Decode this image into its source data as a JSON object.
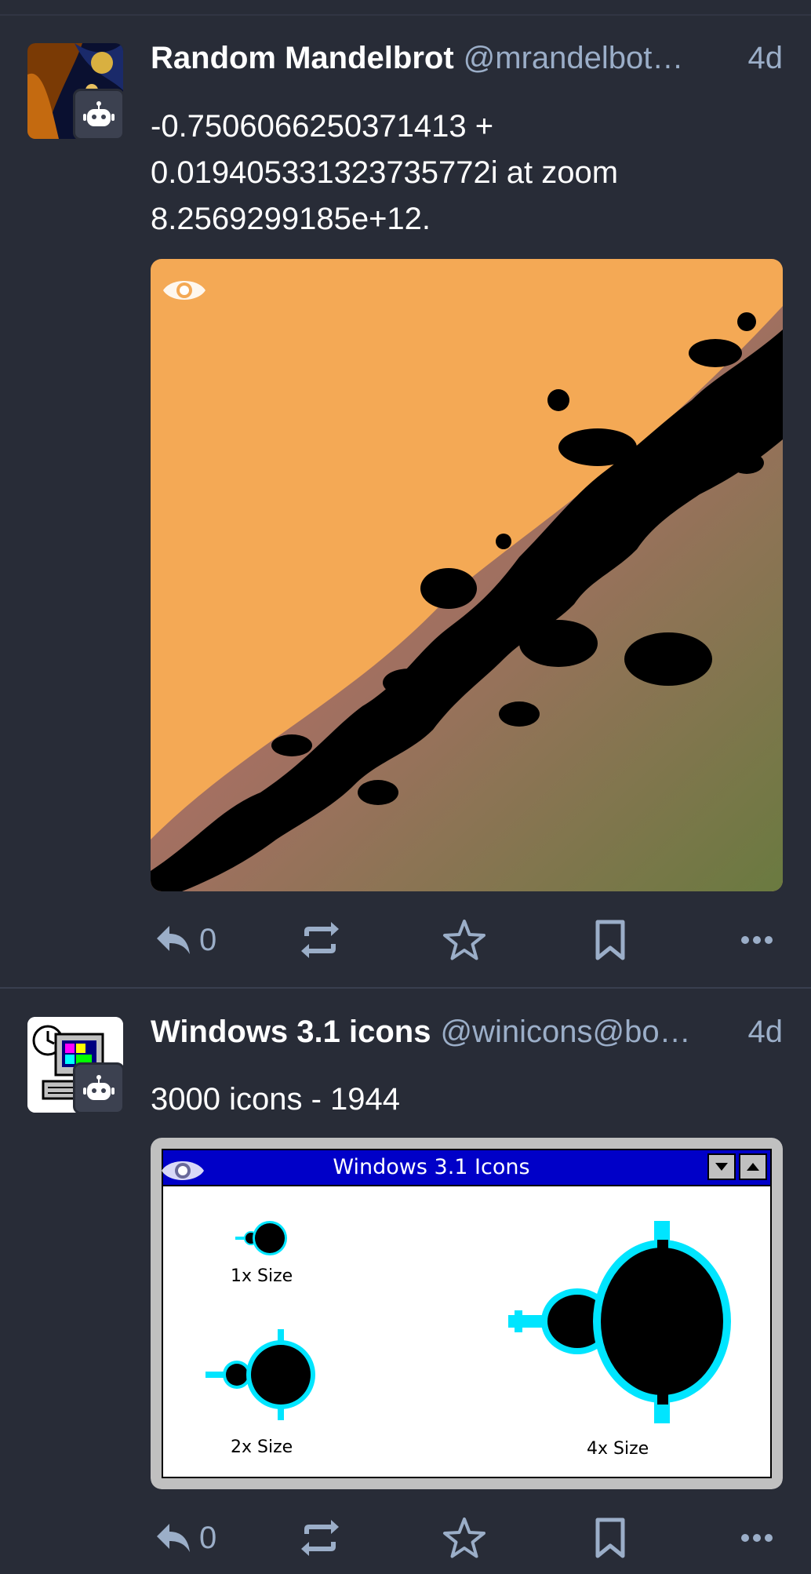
{
  "posts": [
    {
      "display_name": "Random Mandelbrot",
      "acct": "@mrandelbot…",
      "time": "4d",
      "content_lines": [
        "-0.7506066250371413 +",
        "0.019405331323735772i at zoom",
        "8.2569299185e+12."
      ],
      "avatar_icon": "mandelbrot-avatar",
      "badge_icon": "bot-icon",
      "replies": "0"
    },
    {
      "display_name": "Windows 3.1 icons",
      "acct": "@winicons@bo…",
      "time": "4d",
      "content_lines": [
        "3000 icons - 1944"
      ],
      "avatar_icon": "retro-computer-avatar",
      "badge_icon": "bot-icon",
      "replies": "0",
      "media": {
        "window_title": "Windows 3.1 Icons",
        "labels": [
          "1x Size",
          "2x Size",
          "4x Size"
        ]
      }
    }
  ],
  "colors": {
    "background": "#282c37",
    "secondary_text": "#9baec8",
    "media_orange": "#f4a955",
    "win_title_blue": "#0000c8"
  }
}
